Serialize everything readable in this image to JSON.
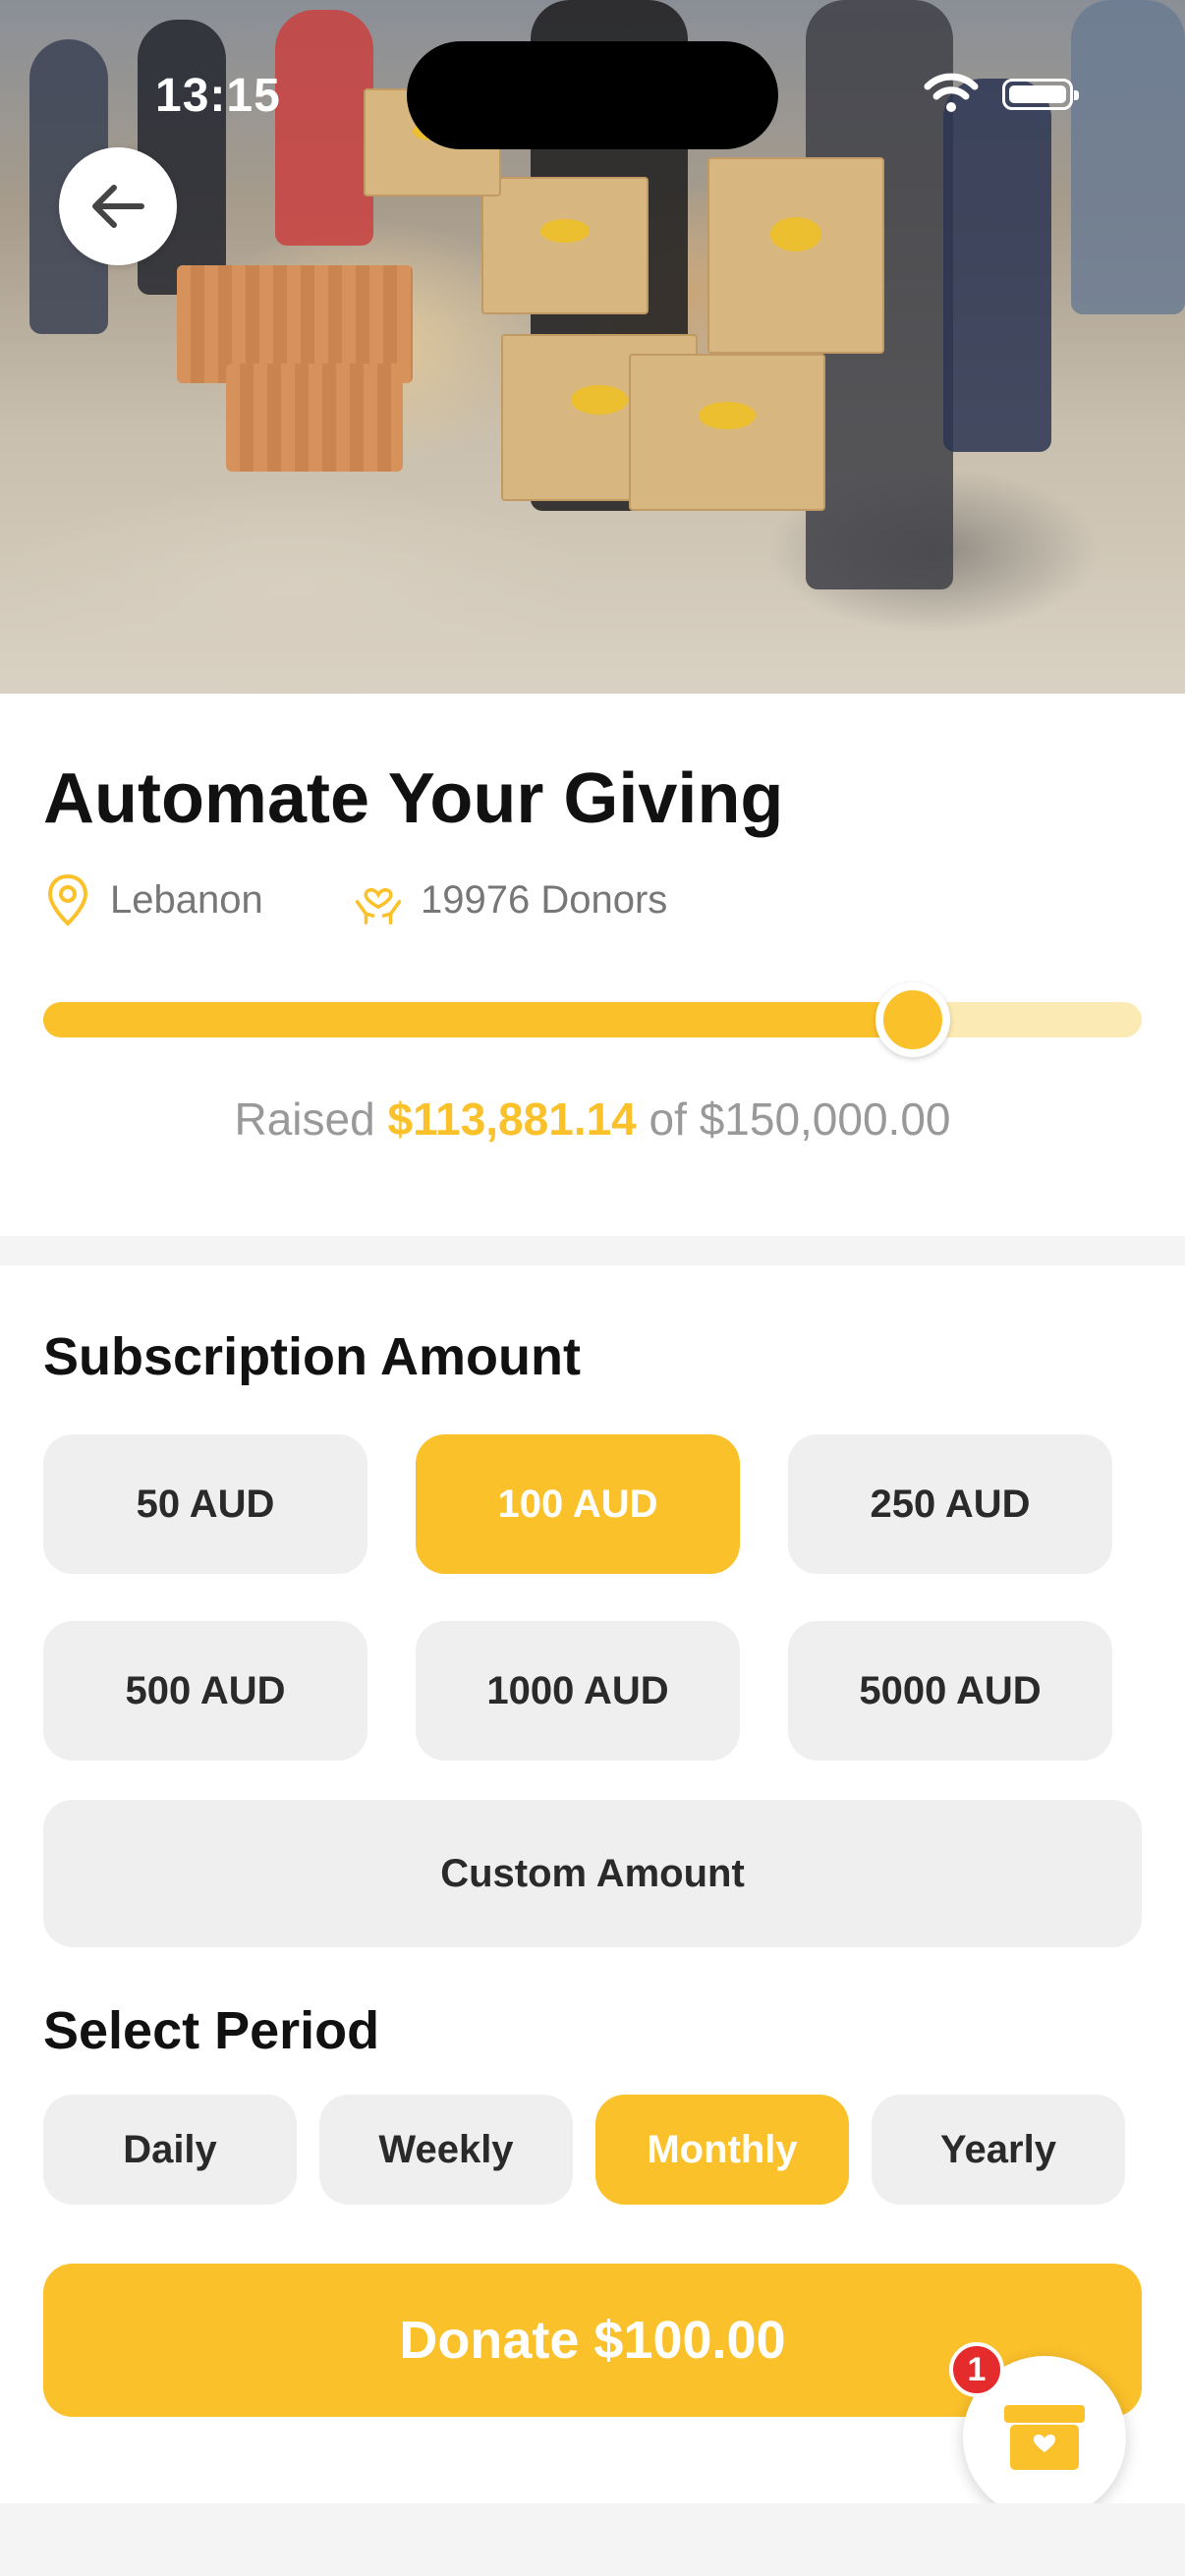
{
  "status_bar": {
    "time": "13:15",
    "icons": [
      "wifi-icon",
      "battery-icon"
    ]
  },
  "hero": {
    "description_icon": "photo",
    "back_icon": "arrow-left-icon"
  },
  "campaign": {
    "title": "Automate Your Giving",
    "location": "Lebanon",
    "donors": "19976 Donors",
    "raised_prefix": "Raised",
    "raised_amount": "$113,881.14",
    "raised_of": "of $150,000.00",
    "progress_fraction": 0.792
  },
  "subscription": {
    "title": "Subscription Amount",
    "amounts": [
      "50 AUD",
      "100 AUD",
      "250 AUD",
      "500 AUD",
      "1000 AUD",
      "5000 AUD"
    ],
    "selected_index": 1,
    "custom_label": "Custom Amount"
  },
  "period": {
    "title": "Select Period",
    "options": [
      "Daily",
      "Weekly",
      "Monthly",
      "Yearly"
    ],
    "selected_index": 2
  },
  "donate_label": "Donate $100.00",
  "cart": {
    "badge_count": "1",
    "icon": "donation-box-icon"
  },
  "colors": {
    "accent": "#fbc12a",
    "accent_light": "#fbeab3",
    "chip_bg": "#efefef",
    "badge": "#e52b2b"
  }
}
